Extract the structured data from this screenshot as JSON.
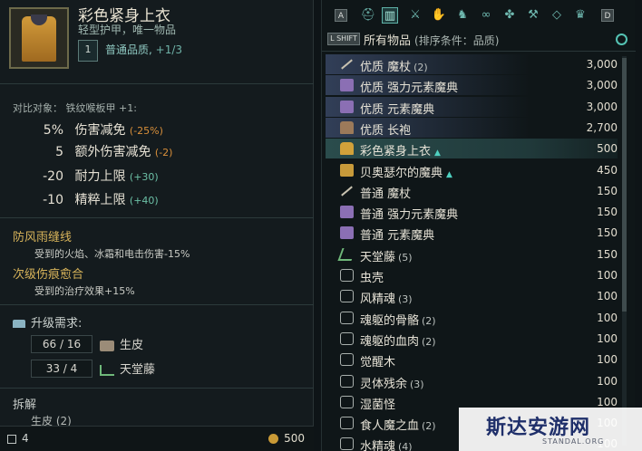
{
  "tooltip": {
    "title": "彩色紧身上衣",
    "subtitle": "轻型护甲，唯一物品",
    "rank": "1",
    "quality_label": "普通品质,",
    "quality_bonus": "+1/3",
    "compare_label": "对比对象：  铁纹喉板甲 +1:",
    "stats": [
      {
        "value": "5%",
        "name": "伤害减免",
        "delta": "(-25%)",
        "positive": false
      },
      {
        "value": "5",
        "name": "额外伤害减免",
        "delta": "(-2)",
        "positive": false
      },
      {
        "value": "-20",
        "name": "耐力上限",
        "delta": "(+30)",
        "positive": true
      },
      {
        "value": "-10",
        "name": "精粹上限",
        "delta": "(+40)",
        "positive": true
      }
    ],
    "perks": [
      {
        "name": "防风雨缝线",
        "desc": "受到的火焰、冰霜和电击伤害-15%"
      },
      {
        "name": "次级伤痕愈合",
        "desc": "受到的治疗效果+15%"
      }
    ],
    "upgrade_title": "升级需求:",
    "requirements": [
      {
        "amount": "66 / 16",
        "name": "生皮"
      },
      {
        "amount": "33 / 4",
        "name": "天堂藤"
      }
    ],
    "disassemble_title": "拆解",
    "disassemble_item": "生皮 (2)",
    "weight": "4",
    "price": "500"
  },
  "inventory": {
    "key_left": "A",
    "key_right": "D",
    "shift_label": "L SHIFT",
    "title": "所有物品",
    "sort_hint": "(排序条件：品质)",
    "items": [
      {
        "name": "优质 魔杖",
        "qty": "(2)",
        "value": "3,000",
        "icon": "wand",
        "style": "hl",
        "new": false
      },
      {
        "name": "优质 强力元素魔典",
        "qty": "",
        "value": "3,000",
        "icon": "book",
        "style": "hl",
        "new": false
      },
      {
        "name": "优质 元素魔典",
        "qty": "",
        "value": "3,000",
        "icon": "book",
        "style": "hl",
        "new": false
      },
      {
        "name": "优质 长袍",
        "qty": "",
        "value": "2,700",
        "icon": "robe",
        "style": "hl",
        "new": false
      },
      {
        "name": "彩色紧身上衣",
        "qty": "",
        "value": "500",
        "icon": "vest",
        "style": "sel",
        "new": true
      },
      {
        "name": "贝奥瑟尔的魔典",
        "qty": "",
        "value": "450",
        "icon": "gbook",
        "style": "",
        "new": true
      },
      {
        "name": "普通 魔杖",
        "qty": "",
        "value": "150",
        "icon": "wand",
        "style": "",
        "new": false
      },
      {
        "name": "普通 强力元素魔典",
        "qty": "",
        "value": "150",
        "icon": "book",
        "style": "",
        "new": false
      },
      {
        "name": "普通 元素魔典",
        "qty": "",
        "value": "150",
        "icon": "book",
        "style": "",
        "new": false
      },
      {
        "name": "天堂藤",
        "qty": "(5)",
        "value": "150",
        "icon": "herb",
        "style": "",
        "new": false
      },
      {
        "name": "虫壳",
        "qty": "",
        "value": "100",
        "icon": "soul",
        "style": "",
        "new": false
      },
      {
        "name": "风精魂",
        "qty": "(3)",
        "value": "100",
        "icon": "soul",
        "style": "",
        "new": false
      },
      {
        "name": "魂躯的骨骼",
        "qty": "(2)",
        "value": "100",
        "icon": "soul",
        "style": "",
        "new": false
      },
      {
        "name": "魂躯的血肉",
        "qty": "(2)",
        "value": "100",
        "icon": "soul",
        "style": "",
        "new": false
      },
      {
        "name": "觉醒木",
        "qty": "",
        "value": "100",
        "icon": "soul",
        "style": "",
        "new": false
      },
      {
        "name": "灵体残余",
        "qty": "(3)",
        "value": "100",
        "icon": "soul",
        "style": "",
        "new": false
      },
      {
        "name": "湿菌怪",
        "qty": "",
        "value": "100",
        "icon": "soul",
        "style": "",
        "new": false
      },
      {
        "name": "食人魔之血",
        "qty": "(2)",
        "value": "100",
        "icon": "soul",
        "style": "",
        "new": false
      },
      {
        "name": "水精魂",
        "qty": "(4)",
        "value": "100",
        "icon": "soul",
        "style": "",
        "new": false
      }
    ]
  },
  "watermark": {
    "text": "斯达安游网",
    "sub": "STANDAL.ORG"
  }
}
